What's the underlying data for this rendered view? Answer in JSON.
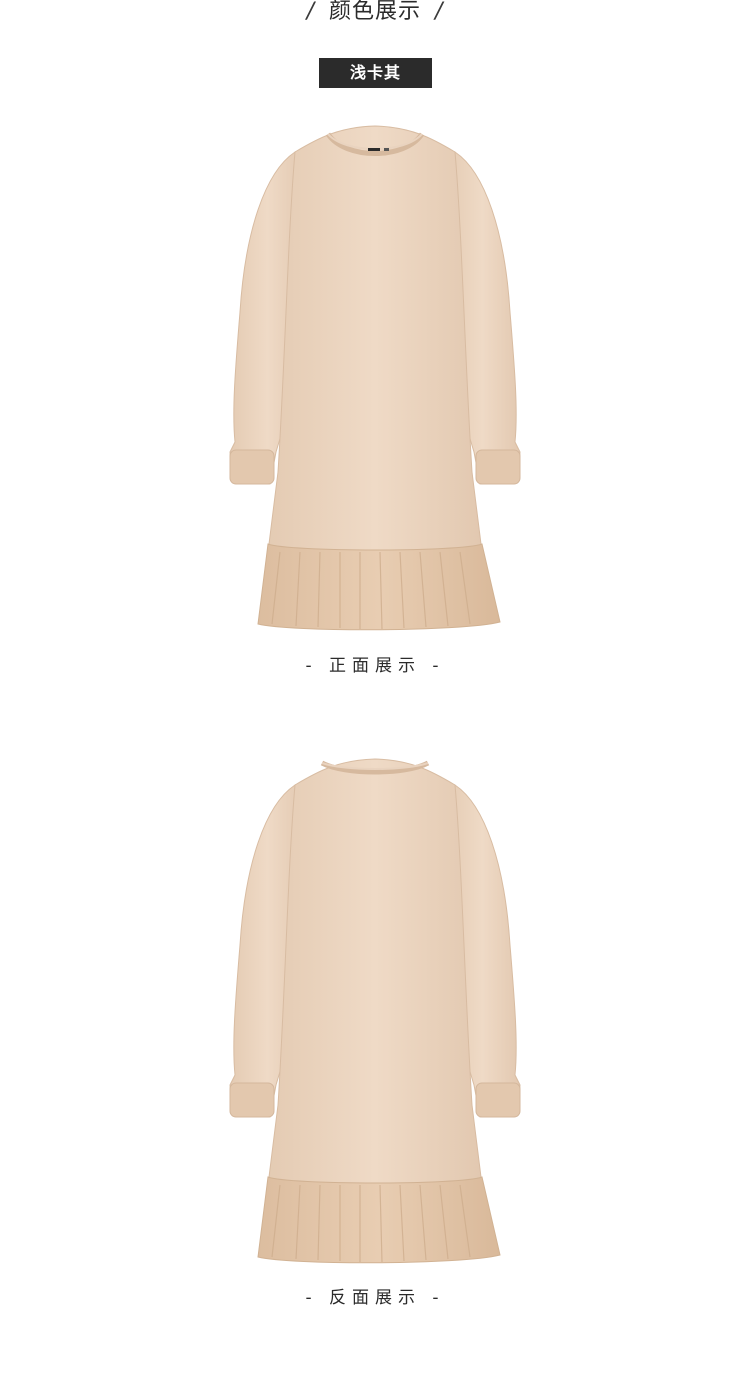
{
  "header": {
    "slash_left": "/",
    "title": "颜色展示",
    "slash_right": "/"
  },
  "color_badge": {
    "label": "浅卡其"
  },
  "front": {
    "caption": "- 正面展示 -"
  },
  "back": {
    "caption": "- 反面展示 -"
  },
  "colors": {
    "badge_bg": "#2b2b2b",
    "dress_body": "#ecd6c1",
    "dress_shadow": "#dcc0a6",
    "ruffle": "#e3c7aa"
  }
}
